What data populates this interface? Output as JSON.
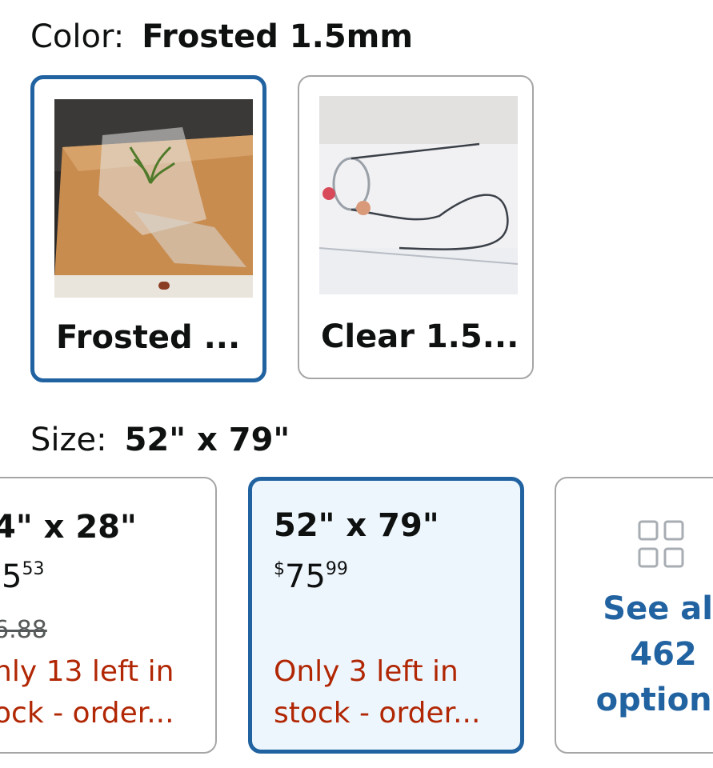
{
  "color": {
    "label": "Color:",
    "selected_value": "Frosted 1.5mm",
    "options": [
      {
        "label": "Frosted ...",
        "image": "frosted-tablecloth-on-wood-table"
      },
      {
        "label": "Clear 1.5...",
        "image": "clear-rolled-tablecloth"
      }
    ]
  },
  "size": {
    "label": "Size:",
    "selected_value": "52\" x 79\"",
    "options": [
      {
        "size": "4\" x 28\"",
        "price_whole": "5",
        "price_fraction": "53",
        "list_price": "6.88",
        "stock_line1": "nly 13 left in",
        "stock_line2": "ock - order..."
      },
      {
        "size": "52\" x 79\"",
        "currency": "$",
        "price_whole": "75",
        "price_fraction": "99",
        "stock_line1": "Only 3 left in",
        "stock_line2": "stock - order..."
      }
    ],
    "see_all": {
      "line1": "See all",
      "line2": "462",
      "line3": "options",
      "icon": "grid-icon"
    }
  },
  "colors": {
    "selected_border": "#2162a1",
    "stock_red": "#b12704",
    "link_blue": "#2162a1",
    "selected_bg": "#eef6fd"
  }
}
